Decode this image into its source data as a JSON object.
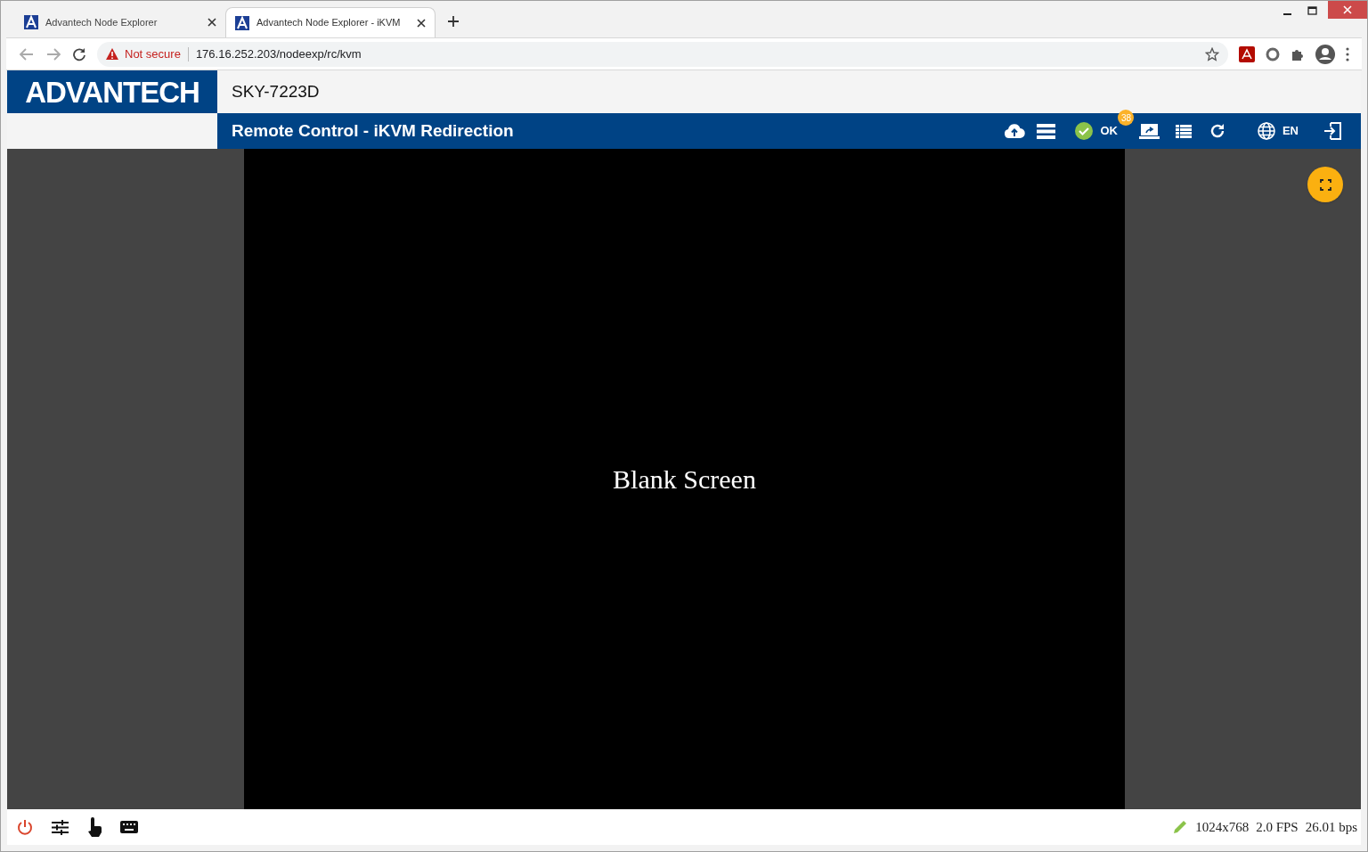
{
  "browser": {
    "tabs": [
      {
        "title": "Advantech Node Explorer",
        "selected": false
      },
      {
        "title": "Advantech Node Explorer - iKVM",
        "selected": true
      }
    ],
    "address": {
      "warning": "Not secure",
      "url": "176.16.252.203/nodeexp/rc/kvm"
    }
  },
  "header": {
    "logo": "ADVANTECH",
    "device": "SKY-7223D",
    "page_title": "Remote Control - iKVM Redirection",
    "health": {
      "status": "OK",
      "badge": "38"
    },
    "language": "EN"
  },
  "kvm": {
    "screen_text": "Blank Screen"
  },
  "status_bar": {
    "resolution": "1024x768",
    "fps": "2.0 FPS",
    "bandwidth": "26.01 bps"
  }
}
